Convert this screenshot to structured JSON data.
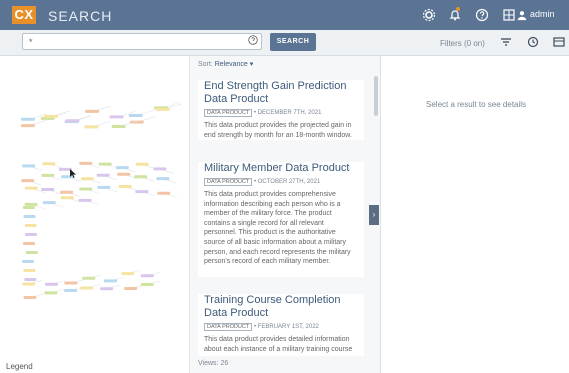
{
  "header": {
    "logo": "CX",
    "title": "SEARCH",
    "user": "admin"
  },
  "search": {
    "value": "*",
    "button_label": "SEARCH",
    "filter_label": "Filters (0 on)"
  },
  "results": {
    "sort_prefix": "Sort:",
    "sort_value": "Relevance ▾",
    "items": [
      {
        "title": "End Strength Gain Prediction Data Product",
        "tag": "DATA PRODUCT",
        "date": "• DECEMBER 7TH, 2021",
        "description": "This data product provides the projected gain in end strength by month for an 18-month window."
      },
      {
        "title": "Military Member Data Product",
        "tag": "DATA PRODUCT",
        "date": "• OCTOBER 27TH, 2021",
        "description": "This data product provides comprehensive information describing each person who is a member of the military force. The product contains a single record for all relevant personnel. This product is the authoritative source of all basic information about a military person, and each record represents the military person's record of each military member."
      },
      {
        "title": "Training Course Completion Data Product",
        "tag": "DATA PRODUCT",
        "date": "• FEBRUARY 1ST, 2022",
        "description": "This data product provides detailed information about each instance of a military training course"
      }
    ],
    "views_label": "Views:",
    "views_count": "26"
  },
  "graph": {
    "legend_label": "Legend"
  },
  "detail": {
    "empty_message": "Select a result to see details"
  },
  "colors": {
    "header_bg": "#5b7493",
    "accent": "#e8912a",
    "node_colors": [
      "#f3c4a6",
      "#cfe4a0",
      "#b8d9ef",
      "#f5e3a1",
      "#d9c6ec"
    ]
  }
}
